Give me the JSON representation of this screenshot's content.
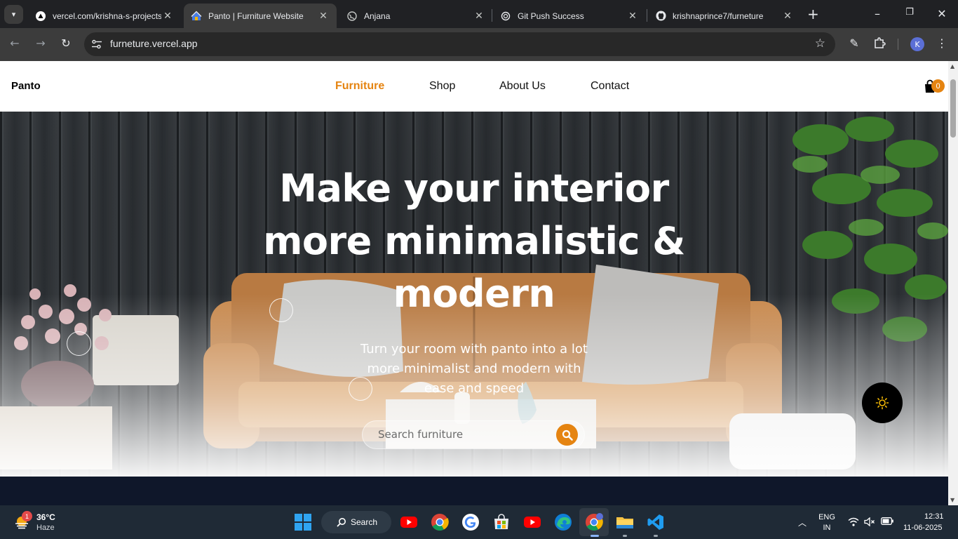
{
  "browser": {
    "tabs": [
      {
        "title": "vercel.com/krishna-s-projects",
        "favicon": "vercel-icon",
        "active": false
      },
      {
        "title": "Panto | Furniture Website",
        "favicon": "house-icon",
        "active": true
      },
      {
        "title": "Anjana",
        "favicon": "globe-icon",
        "active": false
      },
      {
        "title": "Git Push Success",
        "favicon": "openai-icon",
        "active": false
      },
      {
        "title": "krishnaprince7/furneture",
        "favicon": "github-icon",
        "active": false
      }
    ],
    "url": "furneture.vercel.app",
    "profile_initial": "K"
  },
  "site": {
    "logo": "Panto",
    "nav": [
      {
        "label": "Furniture",
        "active": true
      },
      {
        "label": "Shop",
        "active": false
      },
      {
        "label": "About Us",
        "active": false
      },
      {
        "label": "Contact",
        "active": false
      }
    ],
    "cart_count": "0",
    "accent_color": "#e58411"
  },
  "hero": {
    "title": "Make your interior more minimalistic & modern",
    "subtitle": "Turn your room with panto into a lot more minimalist and modern with ease and speed",
    "search_placeholder": "Search furniture"
  },
  "taskbar": {
    "weather_badge": "1",
    "weather_temp": "36°C",
    "weather_desc": "Haze",
    "search_label": "Search",
    "apps": [
      "youtube-icon",
      "chrome-icon",
      "google-icon",
      "store-icon",
      "youtube-icon",
      "edge-icon",
      "chrome-profile-icon",
      "file-explorer-icon",
      "vscode-icon"
    ],
    "language_line1": "ENG",
    "language_line2": "IN",
    "time": "12:31",
    "date": "11-06-2025"
  }
}
